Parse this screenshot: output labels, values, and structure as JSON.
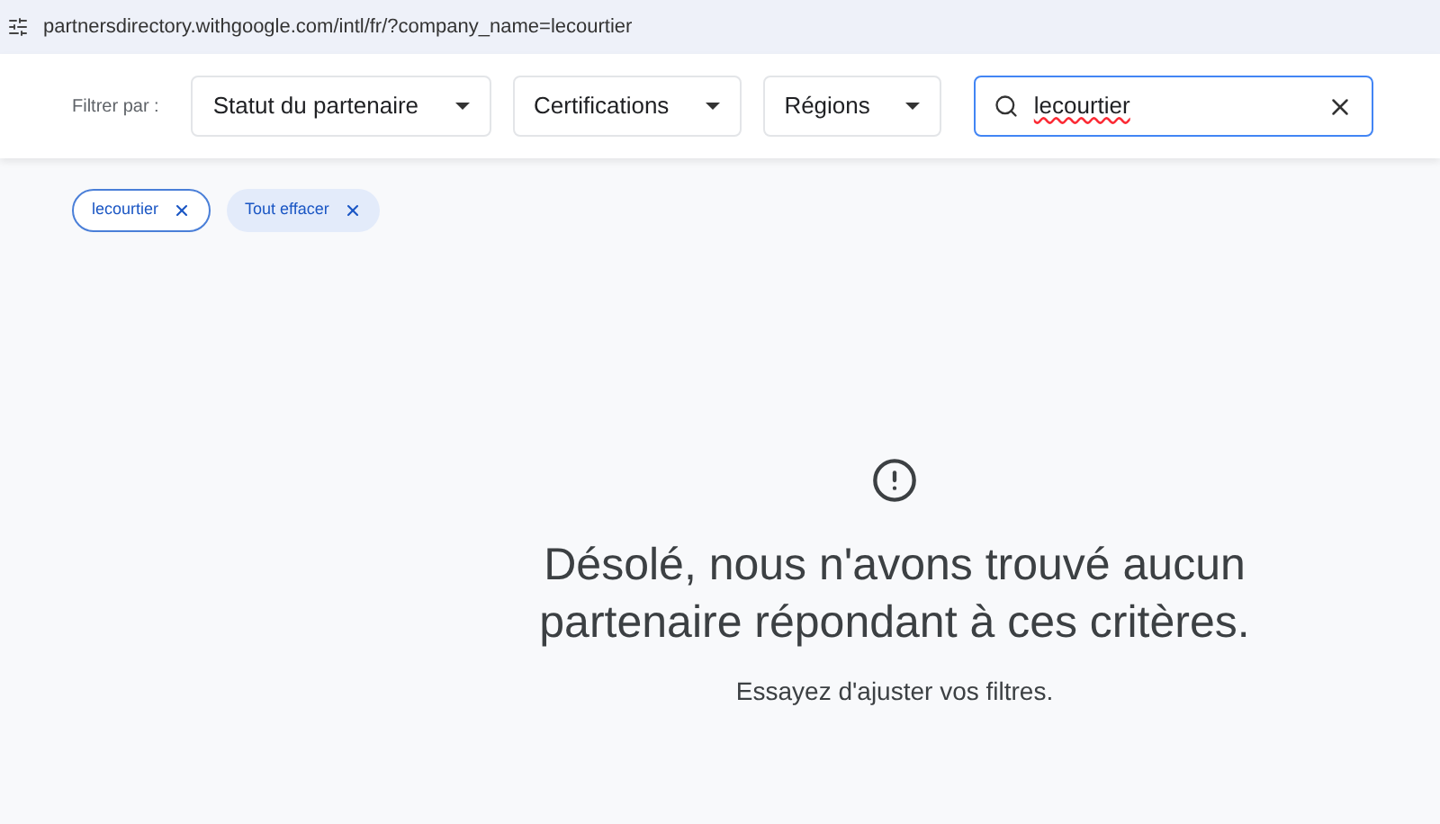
{
  "address_bar": {
    "url": "partnersdirectory.withgoogle.com/intl/fr/?company_name=lecourtier"
  },
  "filter_bar": {
    "label": "Filtrer par :",
    "dropdowns": [
      "Statut du partenaire",
      "Certifications",
      "Régions"
    ],
    "search": {
      "value": "lecourtier"
    }
  },
  "chips": [
    {
      "label": "lecourtier",
      "kind": "filter"
    },
    {
      "label": "Tout effacer",
      "kind": "clear"
    }
  ],
  "empty_state": {
    "title": "Désolé, nous n'avons trouvé aucun partenaire répondant à ces critères.",
    "hint": "Essayez d'ajuster vos filtres."
  }
}
